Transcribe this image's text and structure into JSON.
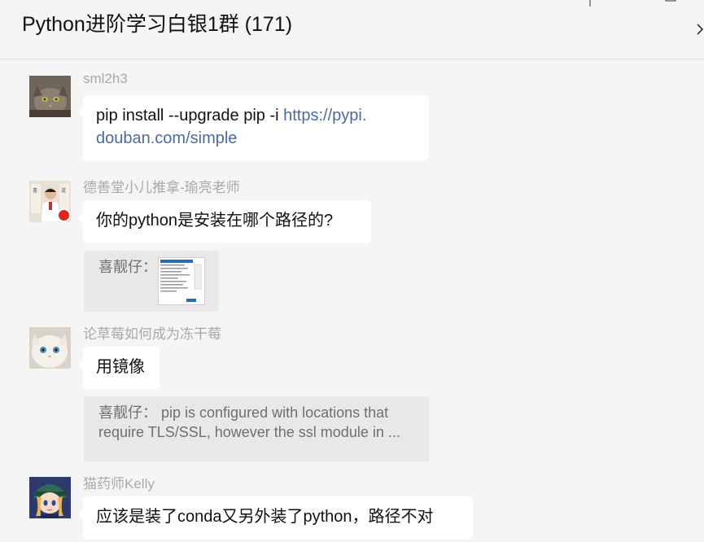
{
  "header": {
    "title": "Python进阶学习白银1群 (171)"
  },
  "icons": {
    "pin": "pin-icon",
    "minimize": "minimize-icon",
    "maximize": "maximize-icon",
    "expand": "chevron-right-icon"
  },
  "messages": [
    {
      "sender": "sml2h3",
      "text_plain": "pip install --upgrade pip -i ",
      "link_line1": "https://pypi.",
      "link_line2": "douban.com/simple"
    },
    {
      "sender": "德善堂小儿推拿-瑜亮老师",
      "text": "你的python是安装在哪个路径的?",
      "quote_author": "喜靓仔："
    },
    {
      "sender": "论草莓如何成为冻干莓",
      "text": "用镜像",
      "quote_line1": "喜靓仔：  pip is configured with locations that",
      "quote_line2": "require TLS/SSL, however the ssl module in ..."
    },
    {
      "sender": "猫药师Kelly",
      "text": "应该是装了conda又另外装了python，路径不对"
    }
  ],
  "colors": {
    "background": "#f5f5f5",
    "bubble": "#ffffff",
    "link": "#4a6aa5",
    "quote_bg": "#e8e8e8",
    "sender": "#a9a9a9"
  }
}
